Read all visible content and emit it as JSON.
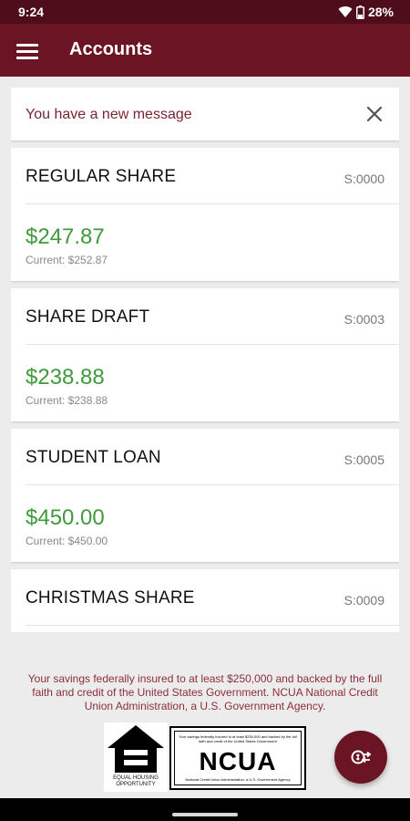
{
  "status_bar": {
    "time": "9:24",
    "battery": "28%"
  },
  "header": {
    "title": "Accounts"
  },
  "message": {
    "text": "You have a new message"
  },
  "accounts": [
    {
      "name": "REGULAR SHARE",
      "number": "S:0000",
      "balance": "$247.87",
      "current": "Current: $252.87"
    },
    {
      "name": "SHARE DRAFT",
      "number": "S:0003",
      "balance": "$238.88",
      "current": "Current: $238.88"
    },
    {
      "name": "STUDENT LOAN",
      "number": "S:0005",
      "balance": "$450.00",
      "current": "Current: $450.00"
    },
    {
      "name": "CHRISTMAS SHARE",
      "number": "S:0009",
      "balance": "",
      "current": ""
    }
  ],
  "footer": {
    "disclaimer": "Your savings federally insured to at least $250,000 and backed by the full faith and credit of the United States Government. NCUA National Credit Union Administration, a U.S. Government Agency.",
    "eho_caption": "EQUAL HOUSING OPPORTUNITY",
    "ncua_top": "Your savings federally insured to at least $250,000 and backed by the full faith and credit of the United States Government",
    "ncua_word": "NCUA",
    "ncua_bottom": "National Credit Union Administration, a U.S. Government Agency"
  },
  "icons": {
    "menu": "menu-icon",
    "close": "close-icon",
    "fab": "transfer-icon"
  },
  "colors": {
    "app_bar": "#6b1424",
    "status_bar": "#4e0d1b",
    "balance": "#3f9a3c",
    "message": "#7a2433",
    "disclaimer": "#8c2d3b"
  }
}
